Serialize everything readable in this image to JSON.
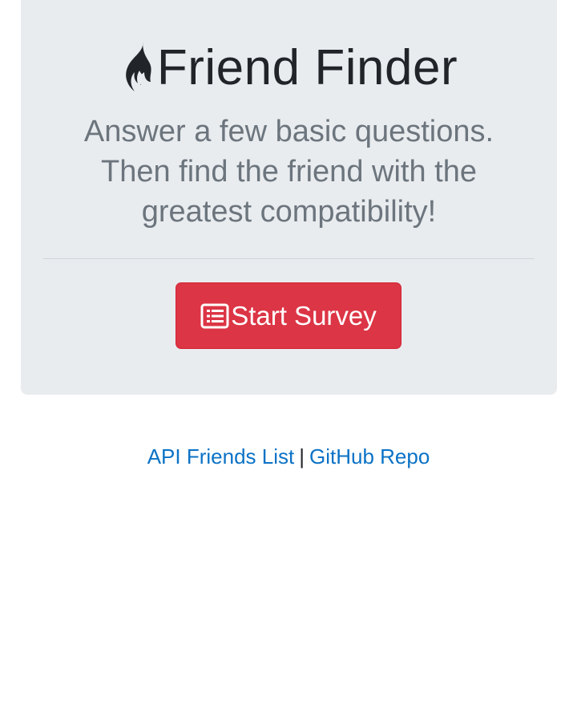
{
  "header": {
    "logo_icon": "fire-icon",
    "title": "Friend Finder"
  },
  "lead": {
    "line1": "Answer a few basic questions.",
    "line2": "Then find the friend with the",
    "line3": "greatest compatibility!"
  },
  "survey_button": {
    "icon": "list-icon",
    "label": "Start Survey"
  },
  "footer": {
    "api_link": "API Friends List",
    "separator": "|",
    "github_link": "GitHub Repo"
  },
  "colors": {
    "jumbotron_bg": "#e9ecef",
    "button_bg": "#dc3545",
    "link": "#0b72c6",
    "title": "#212529",
    "lead": "#6c757d"
  }
}
